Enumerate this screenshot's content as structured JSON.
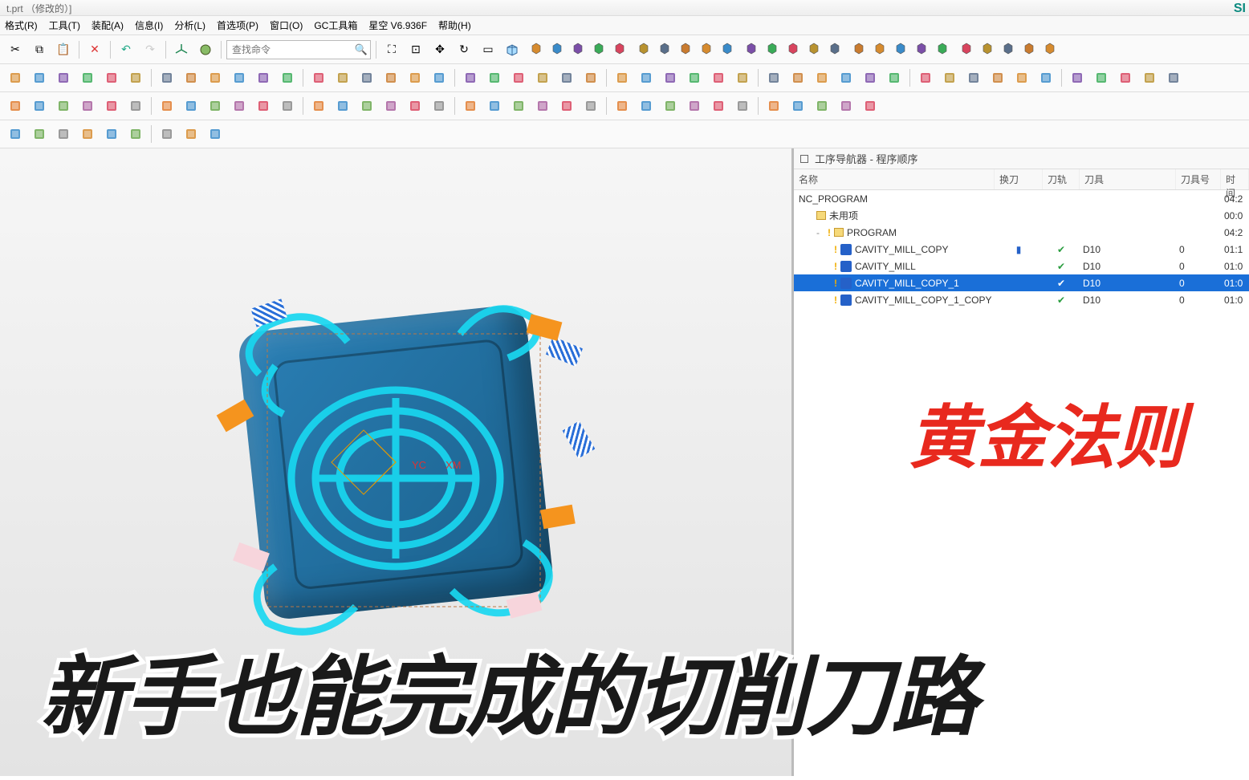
{
  "title_fragment": "t.prt （修改的）]",
  "menu": [
    "格式(R)",
    "工具(T)",
    "装配(A)",
    "信息(I)",
    "分析(L)",
    "首选项(P)",
    "窗口(O)",
    "GC工具箱",
    "星空 V6.936F",
    "帮助(H)"
  ],
  "search_placeholder": "查找命令",
  "nav": {
    "title": "工序导航器 - 程序顺序",
    "columns": {
      "name": "名称",
      "tool_change": "换刀",
      "track": "刀轨",
      "cutter": "刀具",
      "tool_no": "刀具号",
      "time": "时间"
    },
    "rows": [
      {
        "indent": 0,
        "icon": "root",
        "label": "NC_PROGRAM",
        "tc": "",
        "track": "",
        "cutter": "",
        "num": "",
        "time": "04:2"
      },
      {
        "indent": 1,
        "icon": "folder",
        "label": "未用项",
        "tc": "",
        "track": "",
        "cutter": "",
        "num": "",
        "time": "00:0"
      },
      {
        "indent": 1,
        "icon": "program",
        "label": "PROGRAM",
        "tc": "",
        "track": "",
        "cutter": "",
        "num": "",
        "time": "04:2",
        "exclaim": true,
        "expander": "-"
      },
      {
        "indent": 2,
        "icon": "op",
        "label": "CAVITY_MILL_COPY",
        "tc": "▮",
        "track": "✔",
        "cutter": "D10",
        "num": "0",
        "time": "01:1",
        "exclaim": true
      },
      {
        "indent": 2,
        "icon": "op",
        "label": "CAVITY_MILL",
        "tc": "",
        "track": "✔",
        "cutter": "D10",
        "num": "0",
        "time": "01:0",
        "exclaim": true
      },
      {
        "indent": 2,
        "icon": "op",
        "label": "CAVITY_MILL_COPY_1",
        "tc": "",
        "track": "✔",
        "cutter": "D10",
        "num": "0",
        "time": "01:0",
        "exclaim": true,
        "selected": true
      },
      {
        "indent": 2,
        "icon": "op",
        "label": "CAVITY_MILL_COPY_1_COPY",
        "tc": "",
        "track": "✔",
        "cutter": "D10",
        "num": "0",
        "time": "01:0",
        "exclaim": true
      }
    ]
  },
  "overlay_red": "黄金法则",
  "overlay_black": "新手也能完成的切削刀路",
  "brand": "SI",
  "colors": {
    "selection": "#1a6fd8",
    "accent_red": "#e8291e",
    "check": "#2a9d3f",
    "toolpath": "#19d7f0",
    "model": "#2a7fb5",
    "orange": "#f5941e",
    "hatch": "#2a6fd8"
  },
  "toolbar_icons_row1": [
    "scissors",
    "copy",
    "paste",
    "delete",
    "undo",
    "redo",
    "axis-menu",
    "sphere",
    "search",
    "fit",
    "zoom-all",
    "pan",
    "rotate",
    "frame",
    "front",
    "cube-small",
    "cube-trio",
    "shade1",
    "shade2",
    "shade3",
    "shade4",
    "hide-menu",
    "assembly1",
    "assembly2",
    "assembly3",
    "assembly4",
    "paint1",
    "paint2",
    "paint3",
    "paint4",
    "wave1",
    "wave2",
    "wave3",
    "wave4",
    "shape1",
    "shape2",
    "shape3",
    "angle",
    "check",
    "gears",
    "key"
  ],
  "toolbar_icons_row2": [
    "cam-setup",
    "cam-op1",
    "cam-op2",
    "cam-op3",
    "layer1",
    "layer2",
    "layer3",
    "layer4",
    "pattern1",
    "pattern2",
    "pattern3",
    "pattern4",
    "flag1",
    "flag2",
    "flag3",
    "flag4",
    "dim1",
    "dim2",
    "link1",
    "link2",
    "table1",
    "table2",
    "table-shade",
    "play1",
    "play2",
    "play3",
    "play4",
    "clock",
    "machine1",
    "machine2",
    "mc-highlight",
    "nc1",
    "nc2",
    "nc3",
    "nc4",
    "nc5",
    "3d-1",
    "3d-2",
    "3d-3",
    "del",
    "check2",
    "grp1",
    "grp2",
    "grp3",
    "grp4",
    "note1",
    "note2"
  ],
  "toolbar_icons_row3": [
    "grid1",
    "grid2",
    "grid3",
    "gradient",
    "wcs",
    "xform",
    "layers",
    "arrow-l",
    "arrow-r",
    "arrow-u",
    "box",
    "primitive1",
    "primitive2",
    "primitive3",
    "sphere2",
    "cone",
    "helix",
    "blend1",
    "blend2",
    "blend3",
    "cube-o",
    "box-o",
    "wire",
    "cyl",
    "extrude",
    "revolve",
    "rect-dash",
    "polygon",
    "origin",
    "circle-target",
    "circle",
    "square-dash",
    "ellipse",
    "triangle",
    "circle-o"
  ],
  "toolbar_icons_row4": [
    "sketch",
    "measure",
    "target",
    "point",
    "curve",
    "polygon2",
    "rect-dot",
    "inspect",
    "solid-cube"
  ]
}
